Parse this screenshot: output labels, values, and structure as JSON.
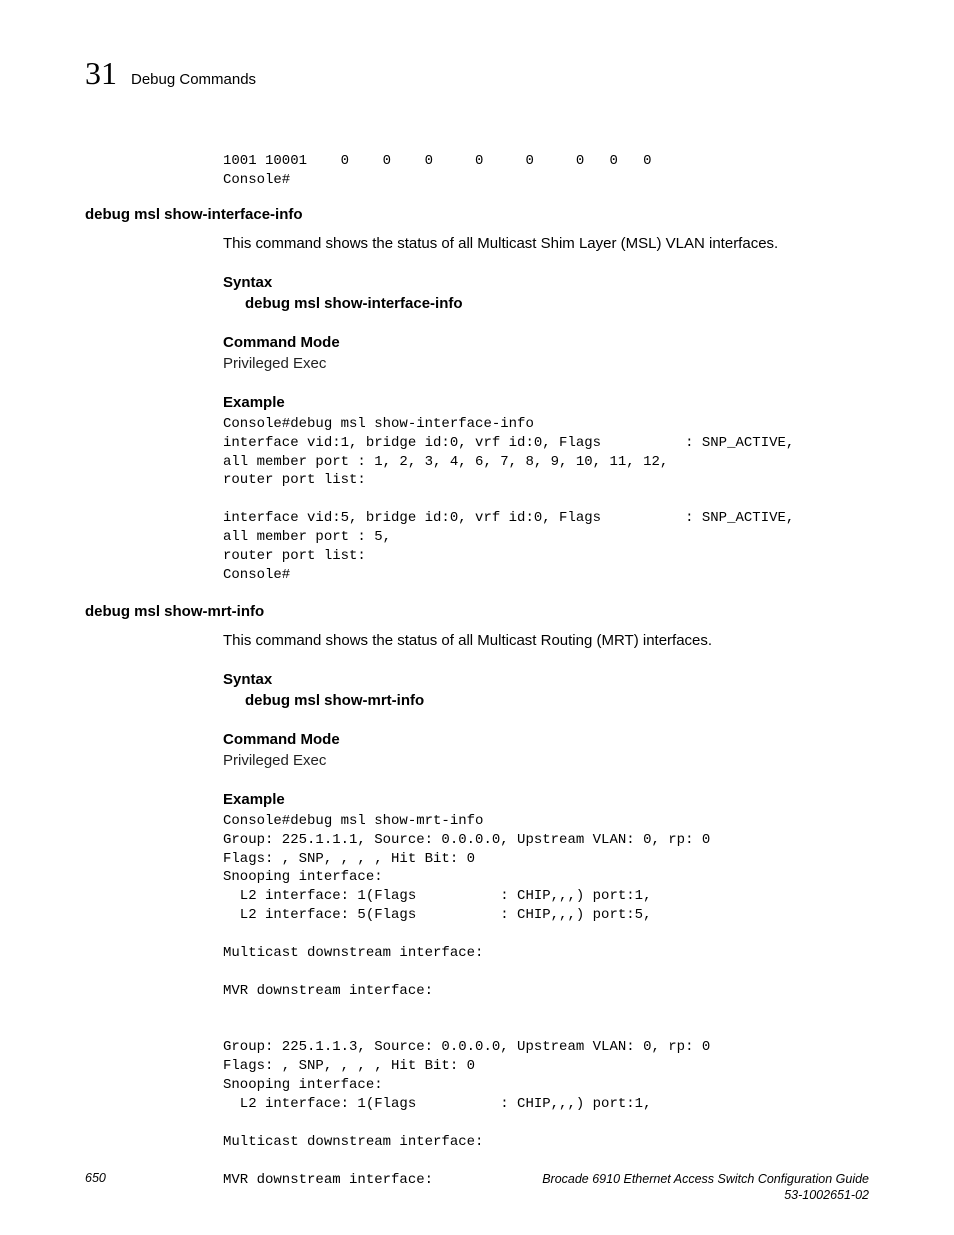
{
  "header": {
    "chapter_number": "31",
    "chapter_title": "Debug Commands"
  },
  "block1": {
    "code": "1001 10001    0    0    0     0     0     0   0   0\nConsole#"
  },
  "section1": {
    "heading": "debug msl show-interface-info",
    "description": "This command shows the status of all Multicast Shim Layer (MSL) VLAN interfaces.",
    "syntax_label": "Syntax",
    "syntax_cmd": "debug msl show-interface-info",
    "mode_label": "Command Mode",
    "mode_value": "Privileged Exec",
    "example_label": "Example",
    "example_code": "Console#debug msl show-interface-info\ninterface vid:1, bridge id:0, vrf id:0, Flags          : SNP_ACTIVE,\nall member port : 1, 2, 3, 4, 6, 7, 8, 9, 10, 11, 12,\nrouter port list:\n\ninterface vid:5, bridge id:0, vrf id:0, Flags          : SNP_ACTIVE,\nall member port : 5,\nrouter port list:\nConsole#"
  },
  "section2": {
    "heading": "debug msl show-mrt-info",
    "description": "This command shows the status of all Multicast Routing (MRT) interfaces.",
    "syntax_label": "Syntax",
    "syntax_cmd": "debug msl show-mrt-info",
    "mode_label": "Command Mode",
    "mode_value": "Privileged Exec",
    "example_label": "Example",
    "example_code": "Console#debug msl show-mrt-info\nGroup: 225.1.1.1, Source: 0.0.0.0, Upstream VLAN: 0, rp: 0\nFlags: , SNP, , , , Hit Bit: 0\nSnooping interface:\n  L2 interface: 1(Flags          : CHIP,,,) port:1,\n  L2 interface: 5(Flags          : CHIP,,,) port:5,\n\nMulticast downstream interface:\n\nMVR downstream interface:\n\n\nGroup: 225.1.1.3, Source: 0.0.0.0, Upstream VLAN: 0, rp: 0\nFlags: , SNP, , , , Hit Bit: 0\nSnooping interface:\n  L2 interface: 1(Flags          : CHIP,,,) port:1,\n\nMulticast downstream interface:\n\nMVR downstream interface:"
  },
  "footer": {
    "page": "650",
    "book": "Brocade 6910 Ethernet Access Switch Configuration Guide",
    "doc": "53-1002651-02"
  }
}
